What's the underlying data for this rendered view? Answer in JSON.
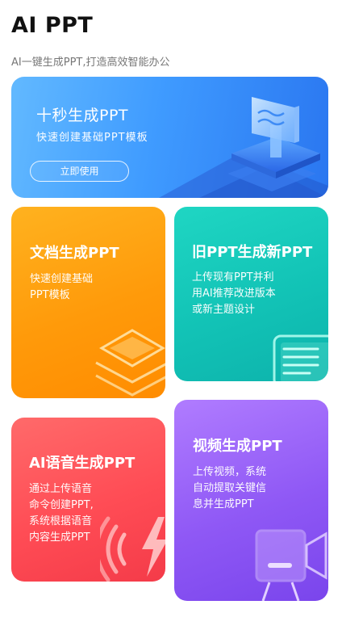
{
  "header": {
    "title": "AI PPT",
    "subtitle": "AI一键生成PPT,打造高效智能办公"
  },
  "hero": {
    "title": "十秒生成PPT",
    "desc": "快速创建基础PPT模板",
    "button": "立即使用",
    "icon": "presentation-board-icon"
  },
  "cards": [
    {
      "title": "文档生成PPT",
      "desc": "快速创建基础\nPPT模板",
      "icon": "stacked-layers-icon",
      "color": "#ff9a0a"
    },
    {
      "title": "旧PPT生成新PPT",
      "desc": "上传现有PPT并利\n用AI推荐改进版本\n或新主题设计",
      "icon": "document-lines-icon",
      "color": "#12c3b6"
    },
    {
      "title": "AI语音生成PPT",
      "desc": "通过上传语音\n命令创建PPT,\n系统根据语音\n内容生成PPT",
      "icon": "sound-wave-icon",
      "color": "#ff4c55"
    },
    {
      "title": "视频生成PPT",
      "desc": "上传视频，系统\n自动提取关键信\n息并生成PPT",
      "icon": "video-camera-icon",
      "color": "#8f58f5"
    }
  ]
}
